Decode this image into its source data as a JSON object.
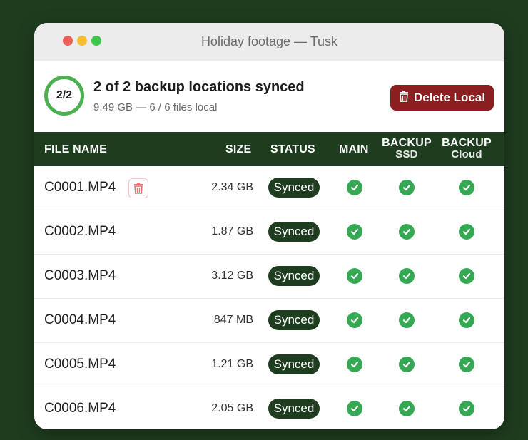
{
  "window": {
    "title": "Holiday footage — Tusk"
  },
  "summary": {
    "ring_label": "2/2",
    "title": "2 of 2 backup locations synced",
    "subtitle": "9.49 GB — 6 / 6 files local",
    "delete_label": "Delete Local"
  },
  "columns": {
    "file_name": "FILE NAME",
    "size": "SIZE",
    "status": "STATUS",
    "main": "MAIN",
    "backup1_top": "BACKUP",
    "backup1_sub": "SSD",
    "backup2_top": "BACKUP",
    "backup2_sub": "Cloud"
  },
  "rows": [
    {
      "name": "C0001.MP4",
      "size": "2.34 GB",
      "status": "Synced"
    },
    {
      "name": "C0002.MP4",
      "size": "1.87 GB",
      "status": "Synced"
    },
    {
      "name": "C0003.MP4",
      "size": "3.12 GB",
      "status": "Synced"
    },
    {
      "name": "C0004.MP4",
      "size": "847 MB",
      "status": "Synced"
    },
    {
      "name": "C0005.MP4",
      "size": "1.21 GB",
      "status": "Synced"
    },
    {
      "name": "C0006.MP4",
      "size": "2.05 GB",
      "status": "Synced"
    }
  ],
  "icons": {
    "trash": "trash-icon",
    "check": "check-circle-icon"
  },
  "colors": {
    "background": "#1e3d1f",
    "accent_green": "#34a853",
    "ring_green": "#4caf50",
    "delete_red": "#8b1e1e"
  }
}
